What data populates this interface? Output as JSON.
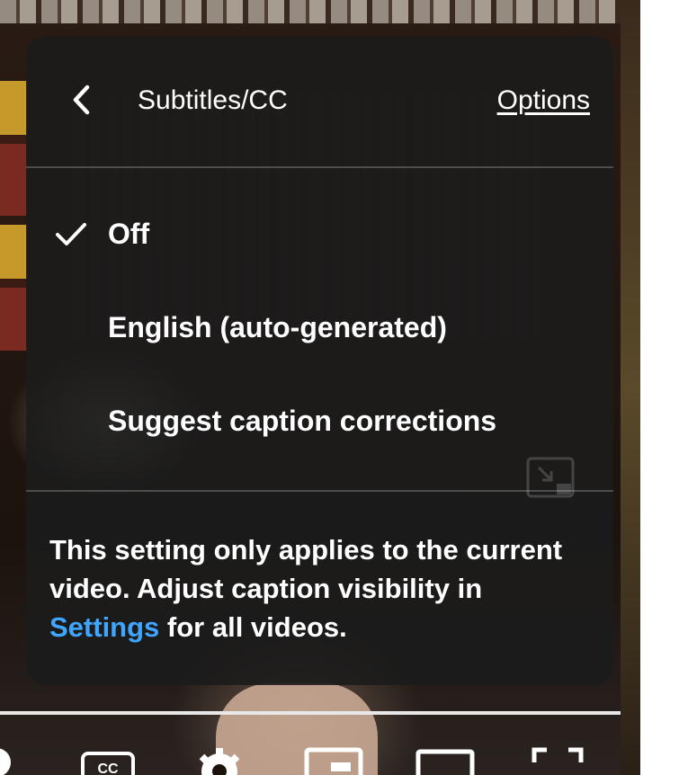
{
  "panel": {
    "title": "Subtitles/CC",
    "options_label": "Options",
    "items": [
      {
        "label": "Off",
        "selected": true
      },
      {
        "label": "English (auto-generated)",
        "selected": false
      },
      {
        "label": "Suggest caption corrections",
        "selected": false
      }
    ],
    "note": {
      "text_before": "This setting only applies to the current video. Adjust caption visibility in",
      "link": "Settings",
      "text_after": " for all videos."
    }
  },
  "player": {
    "progress_fraction": 1.0,
    "controls": [
      "autoplay-toggle-icon",
      "subtitles-cc-icon",
      "settings-gear-icon",
      "miniplayer-icon",
      "theater-mode-icon",
      "fullscreen-icon"
    ]
  },
  "colors": {
    "panel_bg": "#1c1c1c",
    "link_blue": "#3ea6ff",
    "text": "#ffffff"
  }
}
